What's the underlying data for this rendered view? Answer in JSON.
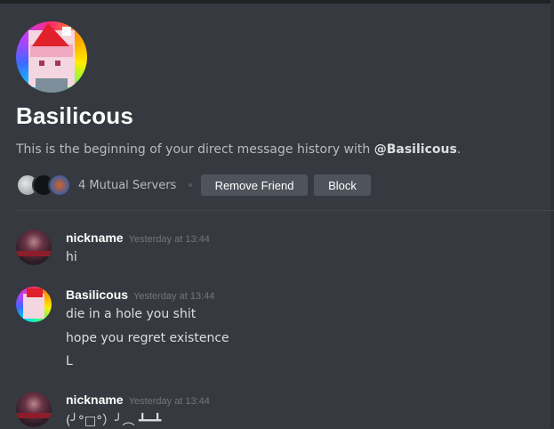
{
  "profile": {
    "name": "Basilicous",
    "intro_prefix": "This is the beginning of your direct message history with ",
    "intro_handle": "@Basilicous",
    "intro_suffix": "."
  },
  "mutual": {
    "label": "4 Mutual Servers"
  },
  "actions": {
    "remove_friend": "Remove Friend",
    "block": "Block"
  },
  "messages": [
    {
      "author": "nickname",
      "timestamp": "Yesterday at 13:44",
      "lines": [
        "hi"
      ]
    },
    {
      "author": "Basilicous",
      "timestamp": "Yesterday at 13:44",
      "lines": [
        "die in a hole you shit",
        "hope you regret existence",
        "L"
      ]
    },
    {
      "author": "nickname",
      "timestamp": "Yesterday at 13:44",
      "lines": [
        "(╯°□°）╯︵ ┻━┻"
      ]
    }
  ],
  "colors": {
    "background": "#36393f",
    "button": "#4f545c",
    "username_text": "#ffffff",
    "timestamp": "#72767d"
  }
}
